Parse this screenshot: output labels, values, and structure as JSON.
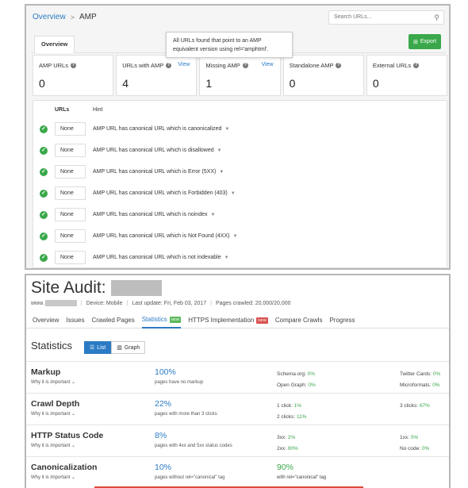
{
  "amp": {
    "breadcrumb": {
      "overview": "Overview",
      "separator": ">",
      "current": "AMP"
    },
    "search": {
      "placeholder": "Search URLs..."
    },
    "tab_overview": "Overview",
    "tooltip": "All URLs found that point to an AMP equivalent version using rel='amphtml'.",
    "export_label": "Export",
    "cards": [
      {
        "label": "AMP URLs",
        "value": "0",
        "view": ""
      },
      {
        "label": "URLs with AMP",
        "value": "4",
        "view": "View"
      },
      {
        "label": "Missing AMP",
        "value": "1",
        "view": "View"
      },
      {
        "label": "Standalone AMP",
        "value": "0",
        "view": ""
      },
      {
        "label": "External URLs",
        "value": "0",
        "view": ""
      }
    ],
    "table": {
      "headers": {
        "urls": "URLs",
        "hint": "Hint"
      },
      "rows": [
        {
          "urls": "None",
          "hint": "AMP URL has canonical URL which is canonicalized"
        },
        {
          "urls": "None",
          "hint": "AMP URL has canonical URL which is disallowed"
        },
        {
          "urls": "None",
          "hint": "AMP URL has canonical URL which is Error (5XX)"
        },
        {
          "urls": "None",
          "hint": "AMP URL has canonical URL which is Forbidden (403)"
        },
        {
          "urls": "None",
          "hint": "AMP URL has canonical URL which is noindex"
        },
        {
          "urls": "None",
          "hint": "AMP URL has canonical URL which is Not Found (4XX)"
        },
        {
          "urls": "None",
          "hint": "AMP URL has canonical URL which is not indexable"
        }
      ]
    }
  },
  "site_audit": {
    "title": "Site Audit:",
    "meta": {
      "domain_prefix": "www.",
      "device": "Device: Mobile",
      "last_update": "Last update: Fri, Feb 03, 2017",
      "pages_crawled": "Pages crawled: 20,000/20,000"
    },
    "tabs": [
      {
        "label": "Overview",
        "badge": ""
      },
      {
        "label": "Issues",
        "badge": ""
      },
      {
        "label": "Crawled Pages",
        "badge": ""
      },
      {
        "label": "Statistics",
        "badge": "NEW"
      },
      {
        "label": "HTTPS Implementation",
        "badge": "NEW"
      },
      {
        "label": "Compare Crawls",
        "badge": ""
      },
      {
        "label": "Progress",
        "badge": ""
      }
    ],
    "stats_heading": "Statistics",
    "view_list": "List",
    "view_graph": "Graph",
    "why_label": "Why it is important",
    "rows": {
      "markup": {
        "name": "Markup",
        "pct": "100%",
        "sub": "pages have no markup",
        "schema_label": "Schema.org:",
        "schema_val": "0%",
        "og_label": "Open Graph:",
        "og_val": "0%",
        "twitter_label": "Twitter Cards:",
        "twitter_val": "0%",
        "micro_label": "Microformats:",
        "micro_val": "0%"
      },
      "crawl_depth": {
        "name": "Crawl Depth",
        "pct": "22%",
        "sub": "pages with more than 3 clicks",
        "c1_label": "1 click:",
        "c1_val": "1%",
        "c2_label": "2 clicks:",
        "c2_val": "11%",
        "c3_label": "3 clicks:",
        "c3_val": "67%"
      },
      "http_status": {
        "name": "HTTP Status Code",
        "pct": "8%",
        "sub": "pages with 4xx and 5xx status codes",
        "s3_label": "3xx:",
        "s3_val": "2%",
        "s2_label": "2xx:",
        "s2_val": "90%",
        "s1_label": "1xx:",
        "s1_val": "0%",
        "nc_label": "No code:",
        "nc_val": "0%"
      },
      "canonicalization": {
        "name": "Canonicalization",
        "pct": "10%",
        "sub": "pages without rel=\"canonical\" tag",
        "with_pct": "90%",
        "with_sub": "with rel=\"canonical\" tag"
      }
    }
  }
}
